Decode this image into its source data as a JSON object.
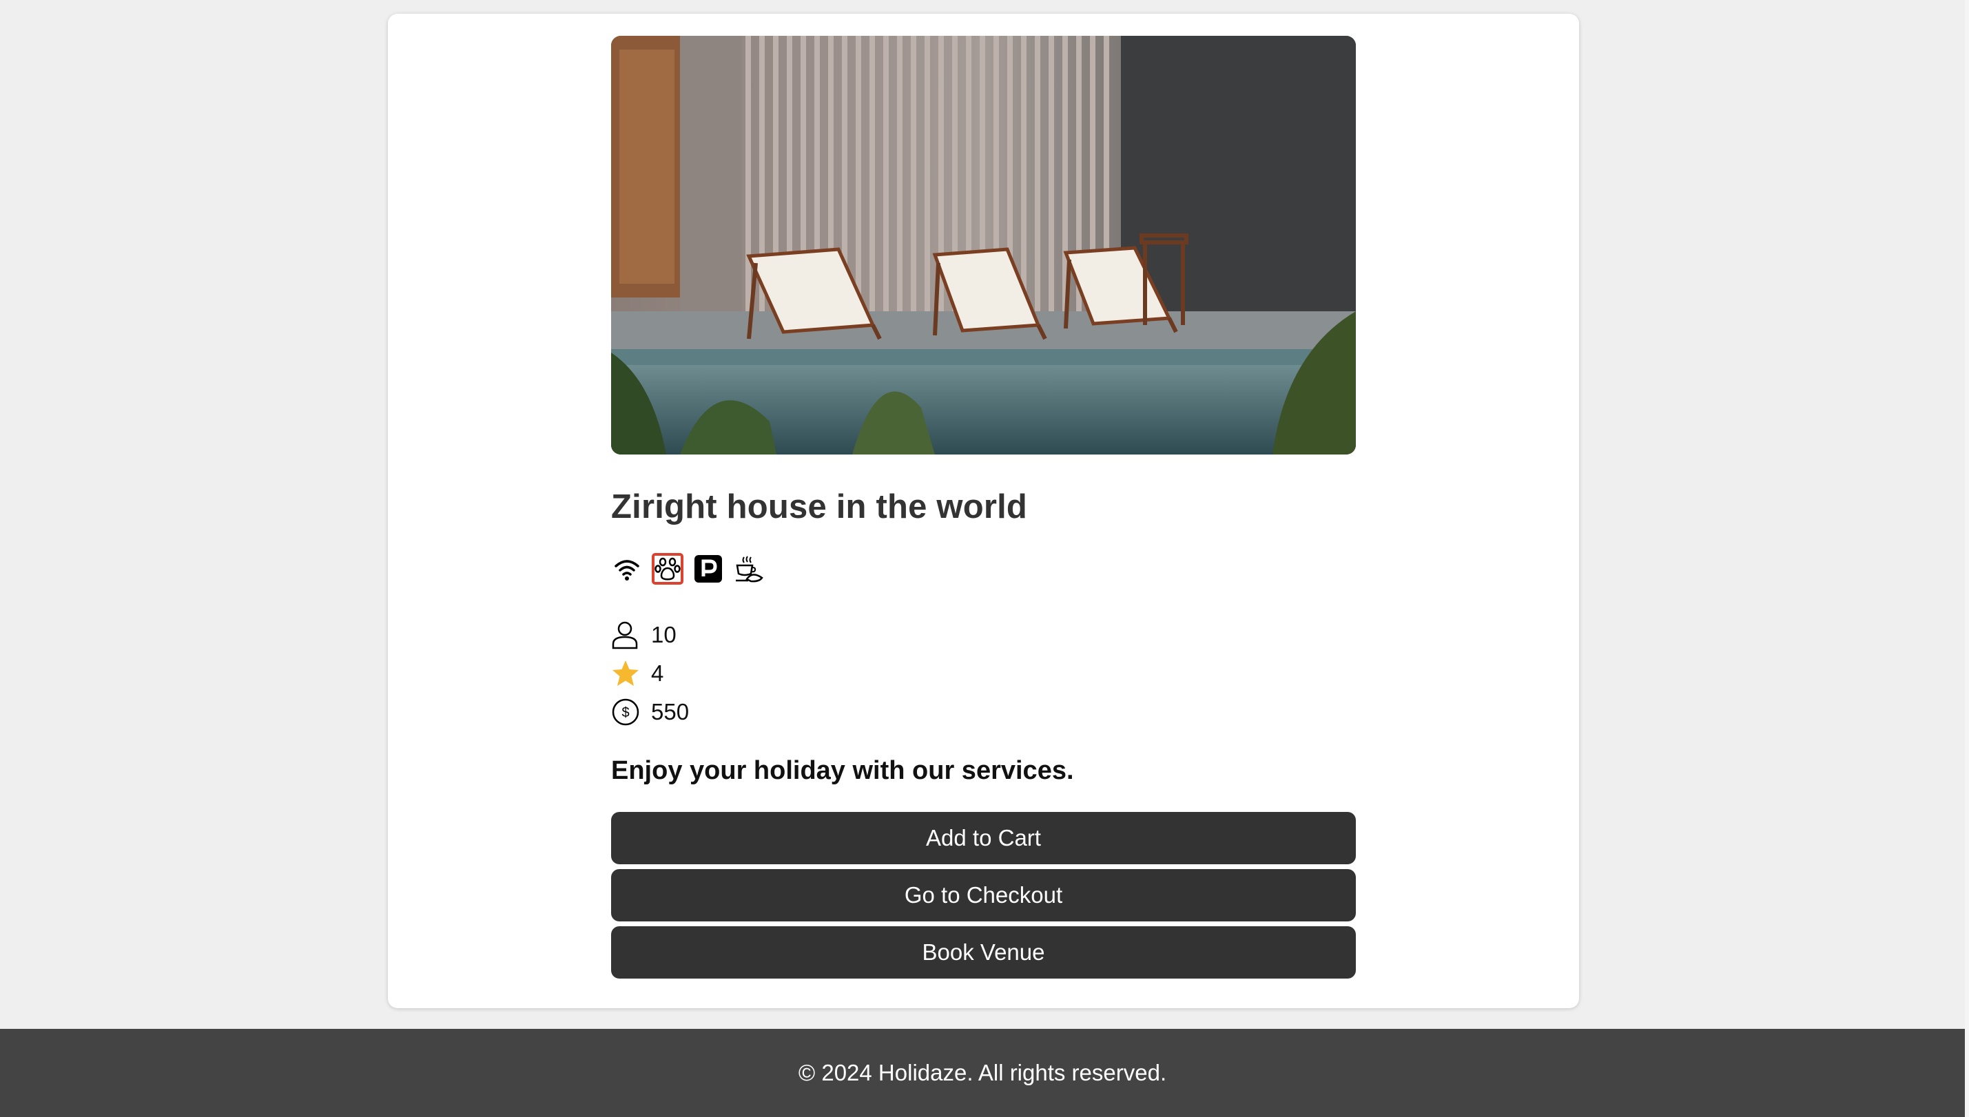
{
  "venue": {
    "name": "Ziright house in the world",
    "amenities": [
      {
        "icon": "wifi-icon"
      },
      {
        "icon": "paw-icon"
      },
      {
        "icon": "parking-icon"
      },
      {
        "icon": "breakfast-icon"
      }
    ],
    "guests": "10",
    "rating": "4",
    "price": "550",
    "tagline": "Enjoy your holiday with our services."
  },
  "actions": {
    "add_to_cart": "Add to Cart",
    "checkout": "Go to Checkout",
    "book": "Book Venue"
  },
  "footer": {
    "text": "© 2024 Holidaze. All rights reserved."
  },
  "colors": {
    "button": "#333333",
    "footer": "#444444",
    "star": "#f5b82e",
    "highlight": "#d9432f"
  }
}
